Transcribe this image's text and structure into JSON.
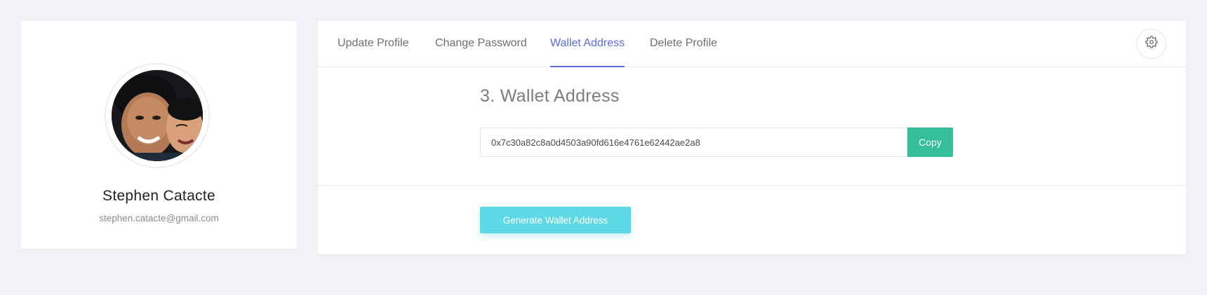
{
  "profile": {
    "name": "Stephen Catacte",
    "email": "stephen.catacte@gmail.com"
  },
  "tabs": [
    {
      "label": "Update Profile",
      "active": false
    },
    {
      "label": "Change Password",
      "active": false
    },
    {
      "label": "Wallet Address",
      "active": true
    },
    {
      "label": "Delete Profile",
      "active": false
    }
  ],
  "settings": {
    "icon": "gear-icon"
  },
  "wallet": {
    "title": "3. Wallet Address",
    "address": "0x7c30a82c8a0d4503a90fd616e4761e62442ae2a8",
    "copy_label": "Copy",
    "generate_label": "Generate Wallet Address"
  },
  "colors": {
    "accent": "#5b6be0",
    "copy_button": "#35bf98",
    "generate_button": "#5dd9e6",
    "background": "#f1f2f7"
  }
}
